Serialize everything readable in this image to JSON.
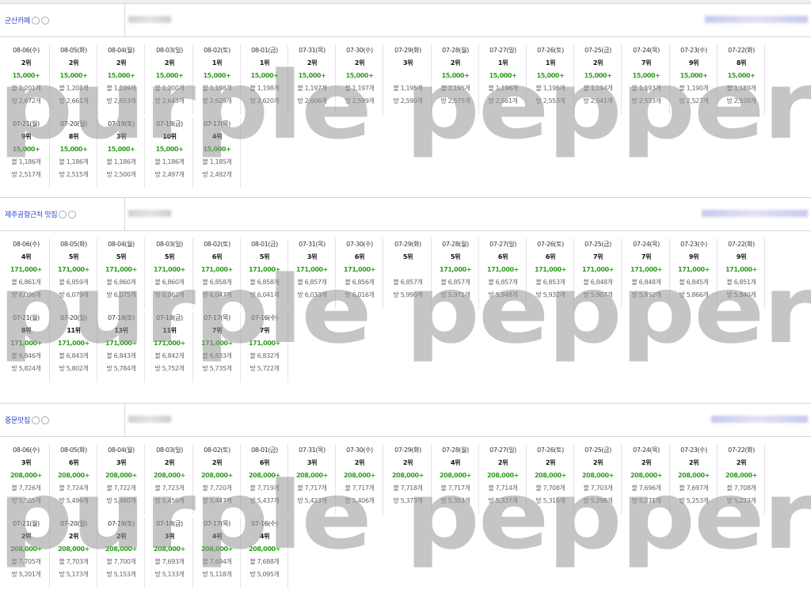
{
  "sections": [
    {
      "keyword": "군산카페",
      "rows": [
        [
          {
            "date": "08-06(수)",
            "rank": "2위",
            "volume": "15,000+",
            "posts": "블 1,201개",
            "cafes": "방 2,672개"
          },
          {
            "date": "08-05(화)",
            "rank": "2위",
            "volume": "15,000+",
            "posts": "블 1,201개",
            "cafes": "방 2,661개"
          },
          {
            "date": "08-04(월)",
            "rank": "2위",
            "volume": "15,000+",
            "posts": "블 1,199개",
            "cafes": "방 2,653개"
          },
          {
            "date": "08-03(일)",
            "rank": "2위",
            "volume": "15,000+",
            "posts": "블 1,200개",
            "cafes": "방 2,643개"
          },
          {
            "date": "08-02(토)",
            "rank": "1위",
            "volume": "15,000+",
            "posts": "블 1,198개",
            "cafes": "방 2,629개"
          },
          {
            "date": "08-01(금)",
            "rank": "1위",
            "volume": "15,000+",
            "posts": "블 1,198개",
            "cafes": "방 2,620개"
          },
          {
            "date": "07-31(목)",
            "rank": "2위",
            "volume": "15,000+",
            "posts": "블 1,197개",
            "cafes": "방 2,606개"
          },
          {
            "date": "07-30(수)",
            "rank": "2위",
            "volume": "15,000+",
            "posts": "블 1,197개",
            "cafes": "방 2,599개"
          },
          {
            "date": "07-29(화)",
            "rank": "3위",
            "volume": "",
            "posts": "블 1,195개",
            "cafes": "방 2,590개"
          },
          {
            "date": "07-28(월)",
            "rank": "2위",
            "volume": "15,000+",
            "posts": "블 1,195개",
            "cafes": "방 2,575개"
          },
          {
            "date": "07-27(일)",
            "rank": "1위",
            "volume": "15,000+",
            "posts": "블 1,196개",
            "cafes": "방 2,561개"
          },
          {
            "date": "07-26(토)",
            "rank": "1위",
            "volume": "15,000+",
            "posts": "블 1,195개",
            "cafes": "방 2,553개"
          },
          {
            "date": "07-25(금)",
            "rank": "2위",
            "volume": "15,000+",
            "posts": "블 1,194개",
            "cafes": "방 2,541개"
          },
          {
            "date": "07-24(목)",
            "rank": "7위",
            "volume": "15,000+",
            "posts": "블 1,193개",
            "cafes": "방 2,533개"
          },
          {
            "date": "07-23(수)",
            "rank": "9위",
            "volume": "15,000+",
            "posts": "블 1,190개",
            "cafes": "방 2,527개"
          },
          {
            "date": "07-22(화)",
            "rank": "8위",
            "volume": "15,000+",
            "posts": "블 1,189개",
            "cafes": "방 2,520개"
          }
        ],
        [
          {
            "date": "07-21(월)",
            "rank": "9위",
            "volume": "15,000+",
            "posts": "블 1,186개",
            "cafes": "방 2,517개"
          },
          {
            "date": "07-20(일)",
            "rank": "8위",
            "volume": "15,000+",
            "posts": "블 1,186개",
            "cafes": "방 2,515개"
          },
          {
            "date": "07-19(토)",
            "rank": "3위",
            "volume": "15,000+",
            "posts": "블 1,186개",
            "cafes": "방 2,500개"
          },
          {
            "date": "07-18(금)",
            "rank": "10위",
            "volume": "15,000+",
            "posts": "블 1,186개",
            "cafes": "방 2,497개"
          },
          {
            "date": "07-17(목)",
            "rank": "4위",
            "volume": "15,000+",
            "posts": "블 1,185개",
            "cafes": "방 2,492개"
          }
        ]
      ]
    },
    {
      "keyword": "제주공항근처 맛집",
      "rows": [
        [
          {
            "date": "08-06(수)",
            "rank": "4위",
            "volume": "171,000+",
            "posts": "블 6,861개",
            "cafes": "방 6,096개"
          },
          {
            "date": "08-05(화)",
            "rank": "5위",
            "volume": "171,000+",
            "posts": "블 6,859개",
            "cafes": "방 6,079개"
          },
          {
            "date": "08-04(월)",
            "rank": "5위",
            "volume": "171,000+",
            "posts": "블 6,860개",
            "cafes": "방 6,075개"
          },
          {
            "date": "08-03(일)",
            "rank": "5위",
            "volume": "171,000+",
            "posts": "블 6,860개",
            "cafes": "방 6,062개"
          },
          {
            "date": "08-02(토)",
            "rank": "6위",
            "volume": "171,000+",
            "posts": "블 6,858개",
            "cafes": "방 6,047개"
          },
          {
            "date": "08-01(금)",
            "rank": "5위",
            "volume": "171,000+",
            "posts": "블 6,858개",
            "cafes": "방 6,041개"
          },
          {
            "date": "07-31(목)",
            "rank": "3위",
            "volume": "171,000+",
            "posts": "블 6,857개",
            "cafes": "방 6,033개"
          },
          {
            "date": "07-30(수)",
            "rank": "6위",
            "volume": "171,000+",
            "posts": "블 6,856개",
            "cafes": "방 6,016개"
          },
          {
            "date": "07-29(화)",
            "rank": "5위",
            "volume": "",
            "posts": "블 6,857개",
            "cafes": "방 5,990개"
          },
          {
            "date": "07-28(월)",
            "rank": "5위",
            "volume": "171,000+",
            "posts": "블 6,857개",
            "cafes": "방 5,971개"
          },
          {
            "date": "07-27(일)",
            "rank": "6위",
            "volume": "171,000+",
            "posts": "블 6,857개",
            "cafes": "방 5,948개"
          },
          {
            "date": "07-26(토)",
            "rank": "6위",
            "volume": "171,000+",
            "posts": "블 6,853개",
            "cafes": "방 5,932개"
          },
          {
            "date": "07-25(금)",
            "rank": "7위",
            "volume": "171,000+",
            "posts": "블 6,848개",
            "cafes": "방 5,907개"
          },
          {
            "date": "07-24(목)",
            "rank": "7위",
            "volume": "171,000+",
            "posts": "블 6,848개",
            "cafes": "방 5,892개"
          },
          {
            "date": "07-23(수)",
            "rank": "9위",
            "volume": "171,000+",
            "posts": "블 6,845개",
            "cafes": "방 5,866개"
          },
          {
            "date": "07-22(화)",
            "rank": "9위",
            "volume": "171,000+",
            "posts": "블 6,851개",
            "cafes": "방 5,840개"
          }
        ],
        [
          {
            "date": "07-21(월)",
            "rank": "8위",
            "volume": "171,000+",
            "posts": "블 6,846개",
            "cafes": "방 5,824개"
          },
          {
            "date": "07-20(일)",
            "rank": "11위",
            "volume": "171,000+",
            "posts": "블 6,843개",
            "cafes": "방 5,802개"
          },
          {
            "date": "07-19(토)",
            "rank": "13위",
            "volume": "171,000+",
            "posts": "블 6,843개",
            "cafes": "방 5,784개"
          },
          {
            "date": "07-18(금)",
            "rank": "11위",
            "volume": "171,000+",
            "posts": "블 6,842개",
            "cafes": "방 5,752개"
          },
          {
            "date": "07-17(목)",
            "rank": "7위",
            "volume": "171,000+",
            "posts": "블 6,833개",
            "cafes": "방 5,735개"
          },
          {
            "date": "07-16(수)",
            "rank": "7위",
            "volume": "171,000+",
            "posts": "블 6,832개",
            "cafes": "방 5,722개"
          }
        ]
      ]
    },
    {
      "keyword": "중문맛집",
      "rows": [
        [
          {
            "date": "08-06(수)",
            "rank": "3위",
            "volume": "208,000+",
            "posts": "블 7,726개",
            "cafes": "방 5,505개"
          },
          {
            "date": "08-05(화)",
            "rank": "6위",
            "volume": "208,000+",
            "posts": "블 7,724개",
            "cafes": "방 5,496개"
          },
          {
            "date": "08-04(월)",
            "rank": "3위",
            "volume": "208,000+",
            "posts": "블 7,722개",
            "cafes": "방 5,480개"
          },
          {
            "date": "08-03(일)",
            "rank": "2위",
            "volume": "208,000+",
            "posts": "블 7,723개",
            "cafes": "방 5,459개"
          },
          {
            "date": "08-02(토)",
            "rank": "2위",
            "volume": "208,000+",
            "posts": "블 7,720개",
            "cafes": "방 5,447개"
          },
          {
            "date": "08-01(금)",
            "rank": "6위",
            "volume": "208,000+",
            "posts": "블 7,719개",
            "cafes": "방 5,437개"
          },
          {
            "date": "07-31(목)",
            "rank": "3위",
            "volume": "208,000+",
            "posts": "블 7,717개",
            "cafes": "방 5,423개"
          },
          {
            "date": "07-30(수)",
            "rank": "2위",
            "volume": "208,000+",
            "posts": "블 7,717개",
            "cafes": "방 5,406개"
          },
          {
            "date": "07-29(화)",
            "rank": "2위",
            "volume": "208,000+",
            "posts": "블 7,718개",
            "cafes": "방 5,373개"
          },
          {
            "date": "07-28(월)",
            "rank": "4위",
            "volume": "208,000+",
            "posts": "블 7,717개",
            "cafes": "방 5,353개"
          },
          {
            "date": "07-27(일)",
            "rank": "2위",
            "volume": "208,000+",
            "posts": "블 7,714개",
            "cafes": "방 5,337개"
          },
          {
            "date": "07-26(토)",
            "rank": "2위",
            "volume": "208,000+",
            "posts": "블 7,708개",
            "cafes": "방 5,316개"
          },
          {
            "date": "07-25(금)",
            "rank": "2위",
            "volume": "208,000+",
            "posts": "블 7,703개",
            "cafes": "방 5,298개"
          },
          {
            "date": "07-24(목)",
            "rank": "2위",
            "volume": "208,000+",
            "posts": "블 7,696개",
            "cafes": "방 5,271개"
          },
          {
            "date": "07-23(수)",
            "rank": "2위",
            "volume": "208,000+",
            "posts": "블 7,697개",
            "cafes": "방 5,253개"
          },
          {
            "date": "07-22(화)",
            "rank": "2위",
            "volume": "208,000+",
            "posts": "블 7,708개",
            "cafes": "방 5,223개"
          }
        ],
        [
          {
            "date": "07-21(월)",
            "rank": "2위",
            "volume": "208,000+",
            "posts": "블 7,705개",
            "cafes": "방 5,201개"
          },
          {
            "date": "07-20(일)",
            "rank": "2위",
            "volume": "208,000+",
            "posts": "블 7,703개",
            "cafes": "방 5,173개"
          },
          {
            "date": "07-19(토)",
            "rank": "2위",
            "volume": "208,000+",
            "posts": "블 7,700개",
            "cafes": "방 5,153개"
          },
          {
            "date": "07-18(금)",
            "rank": "3위",
            "volume": "208,000+",
            "posts": "블 7,693개",
            "cafes": "방 5,133개"
          },
          {
            "date": "07-17(목)",
            "rank": "4위",
            "volume": "208,000+",
            "posts": "블 7,694개",
            "cafes": "방 5,118개"
          },
          {
            "date": "07-16(수)",
            "rank": "4위",
            "volume": "208,000+",
            "posts": "블 7,688개",
            "cafes": "방 5,095개"
          }
        ]
      ]
    }
  ],
  "watermark": "purple pepper",
  "colors": {
    "keyword": "#2a46c8",
    "volume": "#2f9e1f",
    "watermark": "#969696"
  },
  "icons": {
    "keyword_buttons": [
      "info-circle-icon",
      "help-circle-icon"
    ]
  }
}
